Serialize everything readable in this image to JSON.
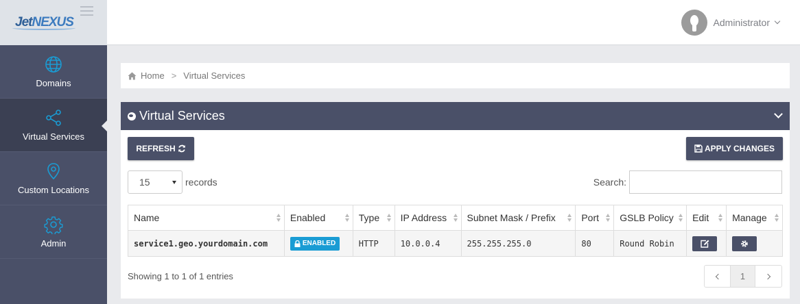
{
  "app": {
    "logo_part1": "Jet",
    "logo_part2": "NEXUS"
  },
  "user": {
    "name": "Administrator"
  },
  "sidebar": {
    "items": [
      {
        "label": "Domains",
        "icon": "globe-icon"
      },
      {
        "label": "Virtual Services",
        "icon": "share-icon"
      },
      {
        "label": "Custom Locations",
        "icon": "location-pin-icon"
      },
      {
        "label": "Admin",
        "icon": "gear-icon"
      }
    ]
  },
  "breadcrumb": {
    "home": "Home",
    "current": "Virtual Services"
  },
  "panel": {
    "title": "Virtual Services",
    "refresh_label": "REFRESH",
    "apply_label": "APPLY CHANGES",
    "records_value": "15",
    "records_label": "records",
    "search_label": "Search:",
    "search_value": ""
  },
  "table": {
    "headers": [
      "Name",
      "Enabled",
      "Type",
      "IP Address",
      "Subnet Mask / Prefix",
      "Port",
      "GSLB Policy",
      "Edit",
      "Manage"
    ],
    "rows": [
      {
        "name": "service1.geo.yourdomain.com",
        "enabled": "ENABLED",
        "type": "HTTP",
        "ip": "10.0.0.4",
        "subnet": "255.255.255.0",
        "port": "80",
        "policy": "Round Robin"
      }
    ]
  },
  "footer": {
    "showing": "Showing 1 to 1 of 1 entries",
    "page": "1"
  },
  "colors": {
    "accent": "#4a5068",
    "badge": "#1a9cd4"
  }
}
